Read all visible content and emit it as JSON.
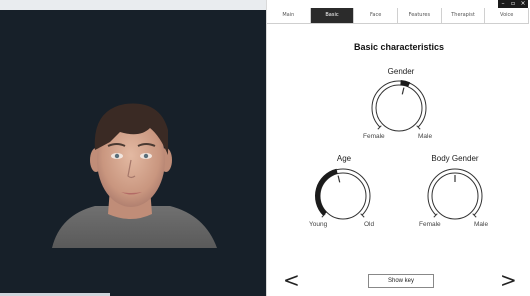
{
  "window": {
    "min_icon": "–",
    "max_icon": "▫",
    "close_icon": "×"
  },
  "tabs": [
    {
      "label": "Main",
      "active": false
    },
    {
      "label": "Basic",
      "active": true
    },
    {
      "label": "Face",
      "active": false
    },
    {
      "label": "Features",
      "active": false
    },
    {
      "label": "Therapist",
      "active": false
    },
    {
      "label": "Voice",
      "active": false
    }
  ],
  "panel": {
    "title": "Basic characteristics",
    "gender": {
      "label": "Gender",
      "min_label": "Female",
      "max_label": "Male",
      "value": 0.55
    },
    "age": {
      "label": "Age",
      "min_label": "Young",
      "max_label": "Old",
      "value": 0.45
    },
    "body_gender": {
      "label": "Body Gender",
      "min_label": "Female",
      "max_label": "Male",
      "value": 0.5
    },
    "prev_icon": "<",
    "next_icon": ">",
    "show_key_label": "Show key"
  },
  "colors": {
    "viewport_bg": "#172029",
    "accent": "#1b1b1b"
  }
}
